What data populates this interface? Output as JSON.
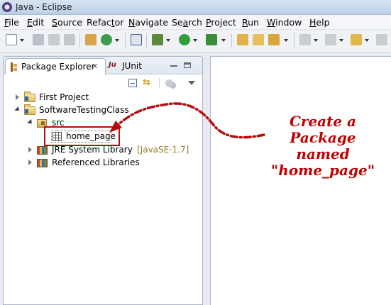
{
  "window": {
    "title": "Java - Eclipse"
  },
  "menubar": {
    "items": [
      {
        "u": "F",
        "rest": "ile"
      },
      {
        "u": "E",
        "rest": "dit"
      },
      {
        "u": "S",
        "rest": "ource"
      },
      {
        "pre": "Refac",
        "u": "t",
        "rest": "or"
      },
      {
        "u": "N",
        "rest": "avigate"
      },
      {
        "pre": "Se",
        "u": "a",
        "rest": "rch"
      },
      {
        "u": "P",
        "rest": "roject"
      },
      {
        "u": "R",
        "rest": "un"
      },
      {
        "u": "W",
        "rest": "indow"
      },
      {
        "u": "H",
        "rest": "elp"
      }
    ]
  },
  "toolbar": {
    "icons": [
      "new-icon",
      "save-icon",
      "save-all-icon",
      "print-icon",
      "new-java-project-icon",
      "new-class-icon",
      "skip-breakpoints-icon",
      "debug-icon",
      "run-icon",
      "external-tools-icon",
      "open-type-icon",
      "open-task-icon",
      "search-icon",
      "next-annotation-icon",
      "previous-annotation-icon",
      "back-icon",
      "forward-icon"
    ]
  },
  "view": {
    "tabs": [
      {
        "label": "Package Explorer",
        "icon": "package-explorer-icon",
        "active": true
      },
      {
        "label": "JUnit",
        "icon": "junit-icon",
        "icon_text": "Ju",
        "active": false
      }
    ],
    "close_glyph": "✕"
  },
  "tree": {
    "items": [
      {
        "label": "First Project",
        "level": 0,
        "expanded": false,
        "icon": "project-folder-icon"
      },
      {
        "label": "SoftwareTestingClass",
        "level": 0,
        "expanded": true,
        "icon": "project-folder-icon"
      },
      {
        "label": "src",
        "level": 1,
        "expanded": true,
        "icon": "source-folder-icon"
      },
      {
        "label": "home_page",
        "level": 2,
        "expanded": false,
        "icon": "package-icon",
        "selected": true
      },
      {
        "label": "JRE System Library",
        "tag": "[JavaSE-1.7]",
        "level": 1,
        "expanded": false,
        "icon": "library-icon"
      },
      {
        "label": "Referenced Libraries",
        "level": 1,
        "expanded": false,
        "icon": "library-icon"
      }
    ]
  },
  "annotation": {
    "lines": [
      "Create a",
      "Package",
      "named",
      "\"home_page\""
    ],
    "color": "#c00000"
  }
}
